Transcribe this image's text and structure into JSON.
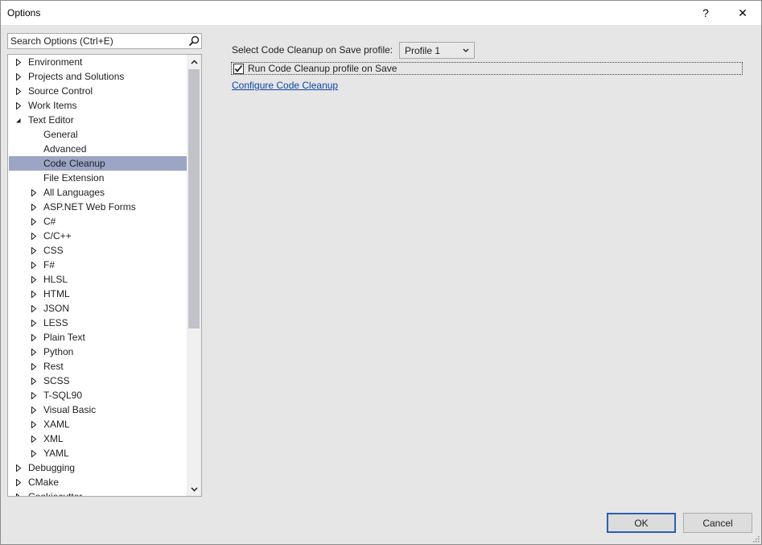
{
  "window": {
    "title": "Options",
    "help_glyph": "?",
    "close_glyph": "✕"
  },
  "search": {
    "placeholder": "Search Options (Ctrl+E)",
    "value": ""
  },
  "tree": {
    "items": [
      {
        "label": "Environment",
        "level": 0,
        "expander": "collapsed"
      },
      {
        "label": "Projects and Solutions",
        "level": 0,
        "expander": "collapsed"
      },
      {
        "label": "Source Control",
        "level": 0,
        "expander": "collapsed"
      },
      {
        "label": "Work Items",
        "level": 0,
        "expander": "collapsed"
      },
      {
        "label": "Text Editor",
        "level": 0,
        "expander": "expanded"
      },
      {
        "label": "General",
        "level": 1,
        "expander": "none"
      },
      {
        "label": "Advanced",
        "level": 1,
        "expander": "none"
      },
      {
        "label": "Code Cleanup",
        "level": 1,
        "expander": "none",
        "selected": true
      },
      {
        "label": "File Extension",
        "level": 1,
        "expander": "none"
      },
      {
        "label": "All Languages",
        "level": 1,
        "expander": "collapsed"
      },
      {
        "label": "ASP.NET Web Forms",
        "level": 1,
        "expander": "collapsed"
      },
      {
        "label": "C#",
        "level": 1,
        "expander": "collapsed"
      },
      {
        "label": "C/C++",
        "level": 1,
        "expander": "collapsed"
      },
      {
        "label": "CSS",
        "level": 1,
        "expander": "collapsed"
      },
      {
        "label": "F#",
        "level": 1,
        "expander": "collapsed"
      },
      {
        "label": "HLSL",
        "level": 1,
        "expander": "collapsed"
      },
      {
        "label": "HTML",
        "level": 1,
        "expander": "collapsed"
      },
      {
        "label": "JSON",
        "level": 1,
        "expander": "collapsed"
      },
      {
        "label": "LESS",
        "level": 1,
        "expander": "collapsed"
      },
      {
        "label": "Plain Text",
        "level": 1,
        "expander": "collapsed"
      },
      {
        "label": "Python",
        "level": 1,
        "expander": "collapsed"
      },
      {
        "label": "Rest",
        "level": 1,
        "expander": "collapsed"
      },
      {
        "label": "SCSS",
        "level": 1,
        "expander": "collapsed"
      },
      {
        "label": "T-SQL90",
        "level": 1,
        "expander": "collapsed"
      },
      {
        "label": "Visual Basic",
        "level": 1,
        "expander": "collapsed"
      },
      {
        "label": "XAML",
        "level": 1,
        "expander": "collapsed"
      },
      {
        "label": "XML",
        "level": 1,
        "expander": "collapsed"
      },
      {
        "label": "YAML",
        "level": 1,
        "expander": "collapsed"
      },
      {
        "label": "Debugging",
        "level": 0,
        "expander": "collapsed"
      },
      {
        "label": "CMake",
        "level": 0,
        "expander": "collapsed"
      },
      {
        "label": "Cookiecutter",
        "level": 0,
        "expander": "collapsed"
      }
    ]
  },
  "panel": {
    "profile_label": "Select Code Cleanup on Save profile:",
    "profile_selected": "Profile 1",
    "run_on_save_label": "Run Code Cleanup profile on Save",
    "run_on_save_checked": true,
    "configure_link": "Configure Code Cleanup"
  },
  "buttons": {
    "ok": "OK",
    "cancel": "Cancel"
  },
  "colors": {
    "selection": "#9da5c5",
    "link": "#0e46a5",
    "default_button_border": "#2b5fae"
  }
}
